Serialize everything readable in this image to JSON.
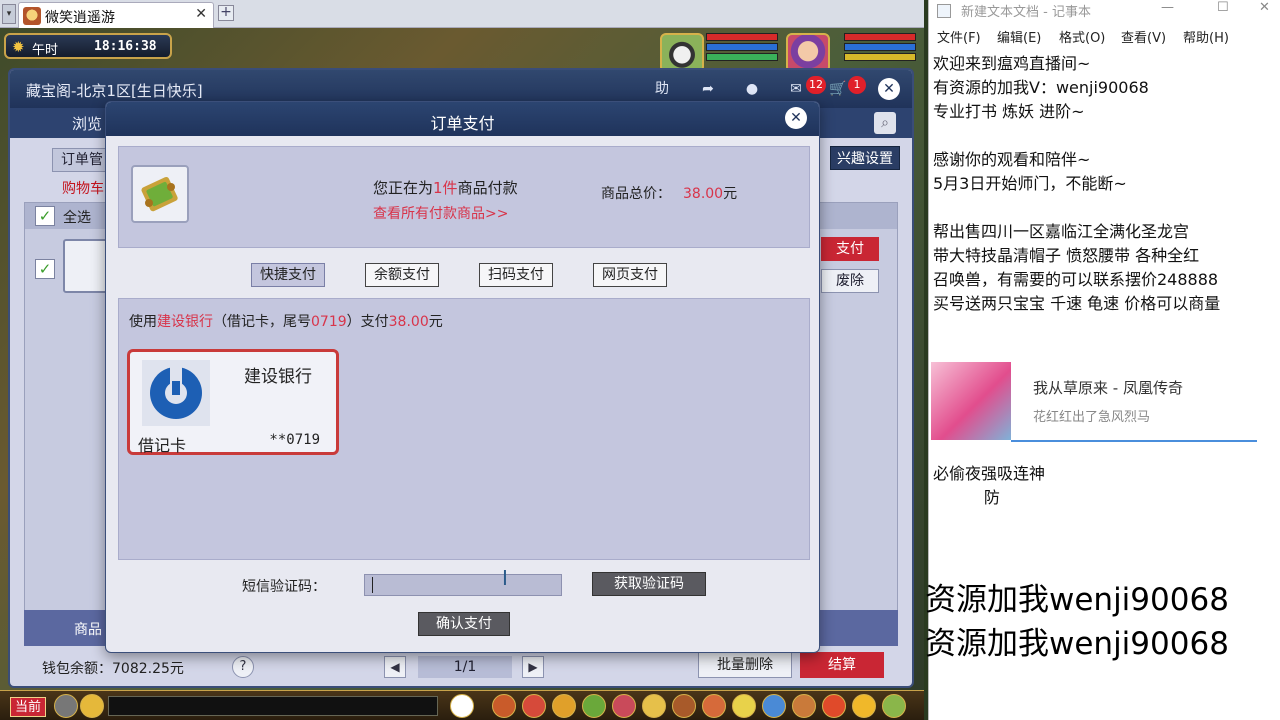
{
  "game": {
    "tab_title": "微笑逍遥游",
    "hud": {
      "period": "午时",
      "time": "18:16:38"
    }
  },
  "cbg": {
    "title": "藏宝阁-北京1区[生日快乐]",
    "nav_browse": "浏览",
    "tab_order": "订单管",
    "interest": "兴趣设置",
    "cart": "购物车",
    "select_all": "全选",
    "pay_label": "支付",
    "discard_label": "废除",
    "badges": {
      "messages": "12",
      "cart": "1"
    },
    "goods_label": "商品",
    "wallet": "钱包余额：7082.25元",
    "help": "?",
    "page": "1/1",
    "batch_delete": "批量删除",
    "checkout": "结算"
  },
  "modal": {
    "title": "订单支付",
    "paying_prefix": "您正在为",
    "paying_count": "1件",
    "paying_suffix": "商品付款",
    "view_all": "查看所有付款商品>>",
    "total_label": "商品总价：",
    "total_amount": "38.00",
    "total_unit": "元",
    "methods": [
      "快捷支付",
      "余额支付",
      "扫码支付",
      "网页支付"
    ],
    "active_method": 0,
    "desc": {
      "p1": "使用",
      "bank": "建设银行",
      "p2": "（借记卡，尾号",
      "tail": "0719",
      "p3": "）支付",
      "amount": "38.00",
      "p4": "元"
    },
    "card": {
      "bank": "建设银行",
      "type": "借记卡",
      "tail": "**0719"
    },
    "sms_label": "短信验证码：",
    "sms_value": "",
    "get_code": "获取验证码",
    "confirm": "确认支付"
  },
  "bottom": {
    "channel": "当前"
  },
  "notepad": {
    "title": "新建文本文档 - 记事本",
    "menu": [
      "文件(F)",
      "编辑(E)",
      "格式(O)",
      "查看(V)",
      "帮助(H)"
    ],
    "lines": [
      "   欢迎来到瘟鸡直播间~",
      "有资源的加我V：wenji90068",
      "专业打书 炼妖 进阶~",
      "",
      "感谢你的观看和陪伴~",
      "5月3日开始师门，不能断~",
      "",
      "帮出售四川一区嘉临江全满化圣龙宫",
      "带大特技晶清帽子 愤怒腰带 各种全红",
      "召唤兽，有需要的可以联系摆价248888",
      "买号送两只宝宝 千速 龟速 价格可以商量"
    ],
    "ad": {
      "title": "我从草原来 - 凤凰传奇",
      "subtitle": "花红红出了急风烈马"
    },
    "lines2": [
      "必偷夜强吸连神",
      "          防"
    ],
    "big_lines": [
      "资源加我wenji90068",
      "资源加我wenji90068"
    ]
  },
  "colors": {
    "accent_red": "#d8344a",
    "title_navy": "#1f335b",
    "card_border": "#c93a3a",
    "ccb_blue": "#1d5fb4"
  }
}
